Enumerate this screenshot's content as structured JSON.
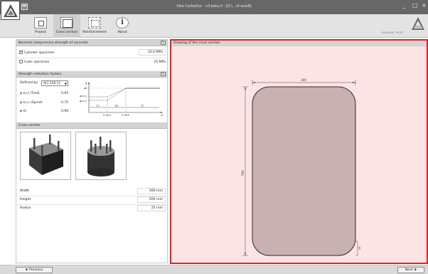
{
  "window": {
    "title": "Sika CarboDur - v3.beta.0 - [D:\\...\\4-axis8]",
    "minimize_glyph": "_",
    "maximize_glyph": "□",
    "close_glyph": "×"
  },
  "ribbon": {
    "tabs": [
      {
        "label": "Project",
        "icon": "project-icon"
      },
      {
        "label": "Cross section",
        "icon": "cross-section-icon"
      },
      {
        "label": "Reinforcement",
        "icon": "reinforcement-icon"
      },
      {
        "label": "About",
        "icon": "info-icon"
      }
    ],
    "active_tab": "Cross section",
    "brand_text": "BUILDING TRUST",
    "brand_logo_text": "Sika"
  },
  "concrete_strength": {
    "title": "Nominal compressive strength of concrete",
    "cylinder": {
      "label": "Cylinder specimen",
      "checked": true,
      "value": "20.0",
      "unit": "MPa"
    },
    "cube": {
      "label": "Cube specimen",
      "checked": false,
      "value": "25",
      "unit": "MPa"
    }
  },
  "strength_reduction": {
    "title": "Strength reduction factors",
    "defined_by_label": "Defined by",
    "code_value": "ACI 318-11",
    "factors": [
      {
        "label": "φ-cc,t (Tied)",
        "value": "0.65"
      },
      {
        "label": "φ-cc,s (Spiral)",
        "value": "0.75"
      },
      {
        "label": "φ-ct",
        "value": "0.90"
      }
    ],
    "diagram": {
      "y_labels": [
        "φ",
        "φt",
        "φcc,s",
        "φcc,t"
      ],
      "zone_labels": [
        "CC",
        "TR",
        "TC"
      ],
      "x_ticks": [
        "0.002",
        "0.005"
      ],
      "x_label": "εt"
    }
  },
  "cross_section": {
    "title": "Cross section",
    "thumbnails": [
      {
        "name": "rectangular-column"
      },
      {
        "name": "circular-column"
      }
    ],
    "fields": [
      {
        "label": "Width",
        "value": "300",
        "unit": "mm"
      },
      {
        "label": "Height",
        "value": "500",
        "unit": "mm"
      },
      {
        "label": "Radius",
        "value": "25",
        "unit": "mm"
      }
    ]
  },
  "drawing": {
    "title": "Drawing of the cross section",
    "dim_width": "300",
    "dim_height": "500",
    "dim_radius": "25",
    "fill_color": "#c9b1b1",
    "highlight_color": "#ee1c1c"
  },
  "navigation": {
    "previous_label": "Previous",
    "next_label": "Next"
  }
}
